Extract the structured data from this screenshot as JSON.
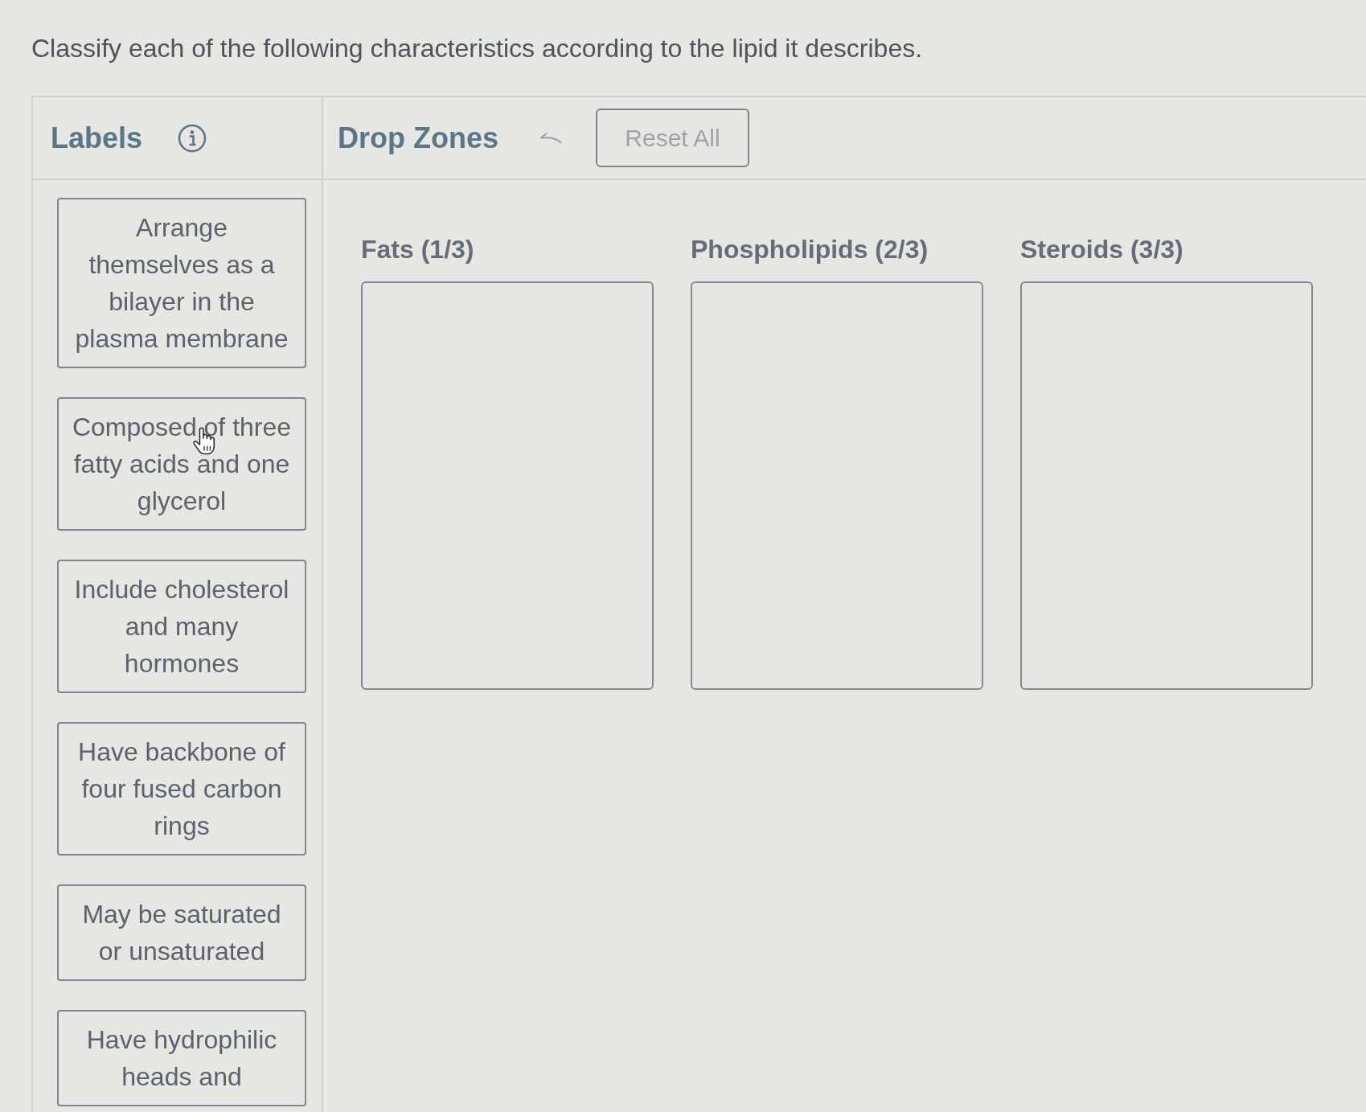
{
  "question": "Classify each of the following characteristics according to the lipid it describes.",
  "labels_panel": {
    "title": "Labels",
    "cards": [
      "Arrange themselves as a bilayer in the plasma membrane",
      "Composed of three fatty acids and one glycerol",
      "Include cholesterol and many hormones",
      "Have backbone of four fused carbon rings",
      "May be saturated or unsaturated",
      "Have hydrophilic heads and"
    ]
  },
  "drop_panel": {
    "title": "Drop Zones",
    "reset_button": "Reset All",
    "zones": [
      {
        "title": "Fats (1/3)"
      },
      {
        "title": "Phospholipids (2/3)"
      },
      {
        "title": "Steroids (3/3)"
      }
    ]
  }
}
